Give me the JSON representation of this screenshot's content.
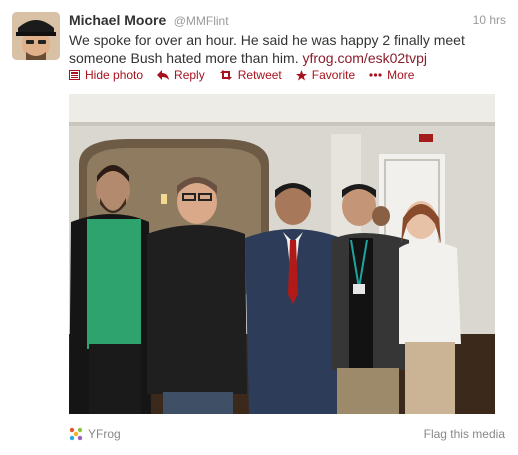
{
  "tweet": {
    "author_name": "Michael Moore",
    "author_handle": "@MMFlint",
    "time": "10 hrs",
    "text": "We spoke for over an hour. He said he was happy 2 finally meet someone Bush hated more than him.",
    "link": "yfrog.com/esk02tvpj"
  },
  "actions": {
    "hide_photo": "Hide photo",
    "reply": "Reply",
    "retweet": "Retweet",
    "favorite": "Favorite",
    "more": "More"
  },
  "media": {
    "provider": "YFrog",
    "flag": "Flag this media"
  },
  "colors": {
    "action_red": "#a8121e",
    "link_red": "#8a1d2b",
    "meta_gray": "#999999"
  },
  "icons": [
    "photo-icon",
    "reply-arrow-icon",
    "retweet-icon",
    "star-icon",
    "more-dots-icon",
    "yfrog-logo-icon"
  ]
}
